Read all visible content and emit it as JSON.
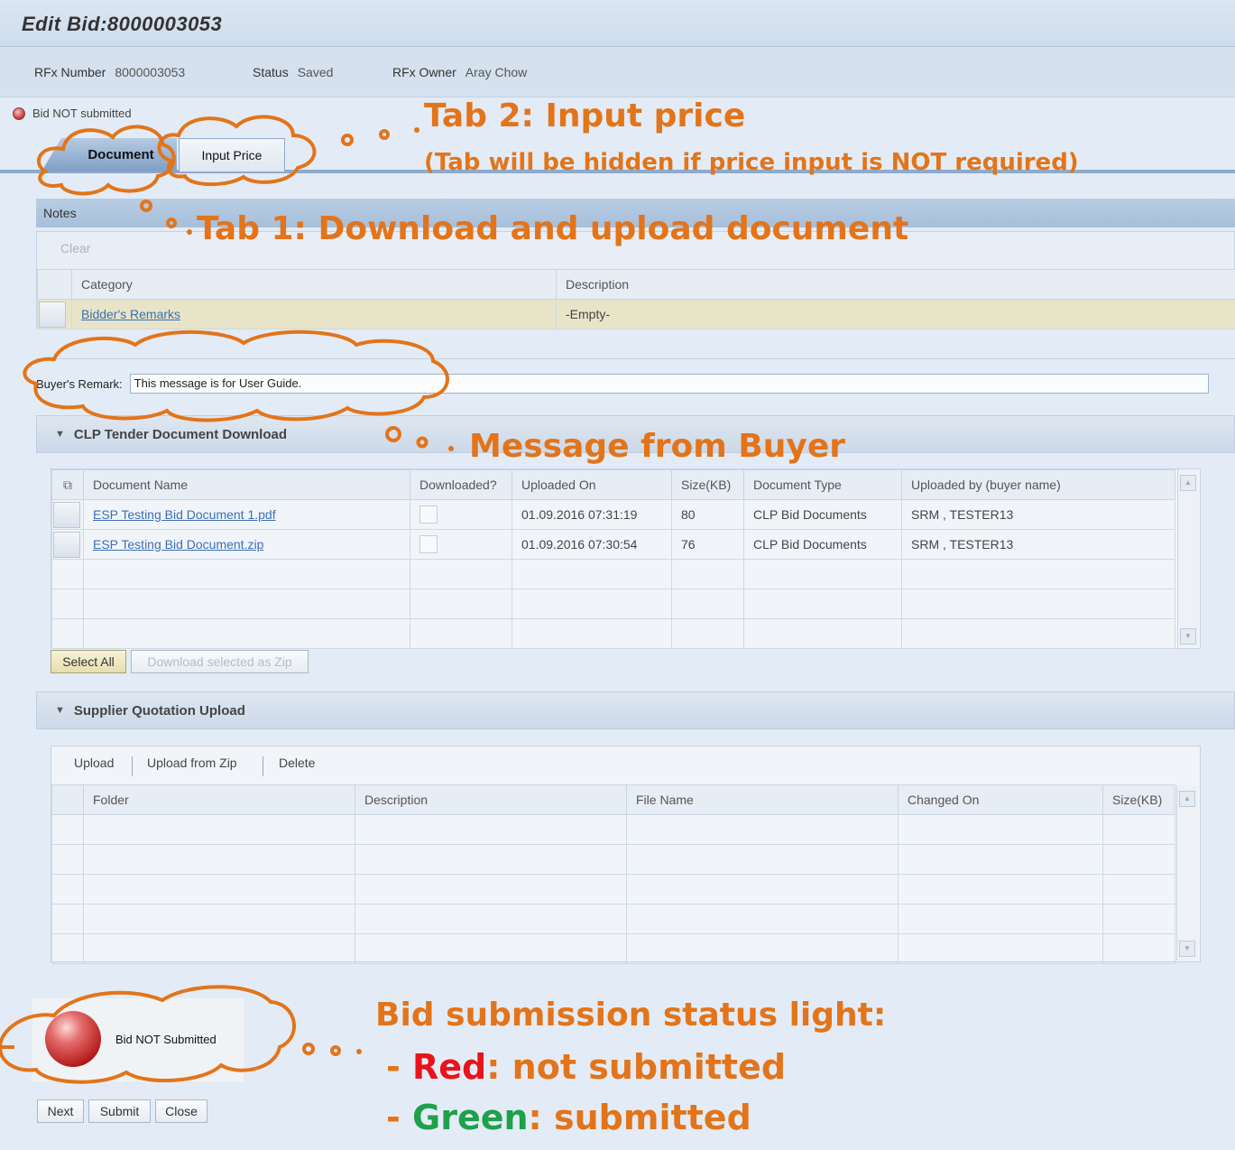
{
  "header": {
    "title": "Edit Bid:8000003053",
    "rfx_number_label": "RFx Number",
    "rfx_number": "8000003053",
    "status_label": "Status",
    "status": "Saved",
    "owner_label": "RFx Owner",
    "owner": "Aray Chow"
  },
  "bid_status_text": "Bid NOT submitted",
  "tabs": [
    {
      "label": "Document",
      "active": true
    },
    {
      "label": "Input Price",
      "active": false
    }
  ],
  "notes": {
    "title": "Notes",
    "clear_label": "Clear",
    "columns": [
      "Category",
      "Description"
    ],
    "rows": [
      {
        "category": "Bidder's Remarks",
        "description": "-Empty-"
      }
    ]
  },
  "buyer_remark": {
    "label": "Buyer's Remark:",
    "value": "This message is for User Guide."
  },
  "tender_download": {
    "title": "CLP Tender Document Download",
    "columns": [
      "Document Name",
      "Downloaded?",
      "Uploaded On",
      "Size(KB)",
      "Document Type",
      "Uploaded by (buyer name)"
    ],
    "rows": [
      {
        "name": "ESP Testing Bid Document 1.pdf",
        "uploaded_on": "01.09.2016 07:31:19",
        "size": "80",
        "type": "CLP Bid Documents",
        "by": "SRM , TESTER13"
      },
      {
        "name": "ESP Testing Bid Document.zip",
        "uploaded_on": "01.09.2016 07:30:54",
        "size": "76",
        "type": "CLP Bid Documents",
        "by": "SRM , TESTER13"
      }
    ],
    "select_all_label": "Select All",
    "download_zip_label": "Download selected as Zip"
  },
  "quotation_upload": {
    "title": "Supplier Quotation Upload",
    "toolbar": [
      "Upload",
      "Upload from Zip",
      "Delete"
    ],
    "columns": [
      "Folder",
      "Description",
      "File Name",
      "Changed On",
      "Size(KB)"
    ]
  },
  "status_panel": {
    "text": "Bid NOT Submitted",
    "light_color": "red"
  },
  "footer_buttons": [
    "Next",
    "Submit",
    "Close"
  ],
  "annotations": {
    "tab2_title": "Tab 2: Input price",
    "tab2_note": "(Tab will be hidden if price input is NOT required)",
    "tab1": "Tab 1: Download and upload document",
    "buyer_msg": "Message from Buyer",
    "status_title": "Bid submission status light:",
    "dash": "-",
    "red_word": "Red",
    "red_rest": ": not submitted",
    "green_word": "Green",
    "green_rest": ": submitted"
  },
  "colors": {
    "annotation": "#e3741a",
    "red": "#e8141b",
    "green": "#1fa04a",
    "accent": "#8eaacc"
  }
}
